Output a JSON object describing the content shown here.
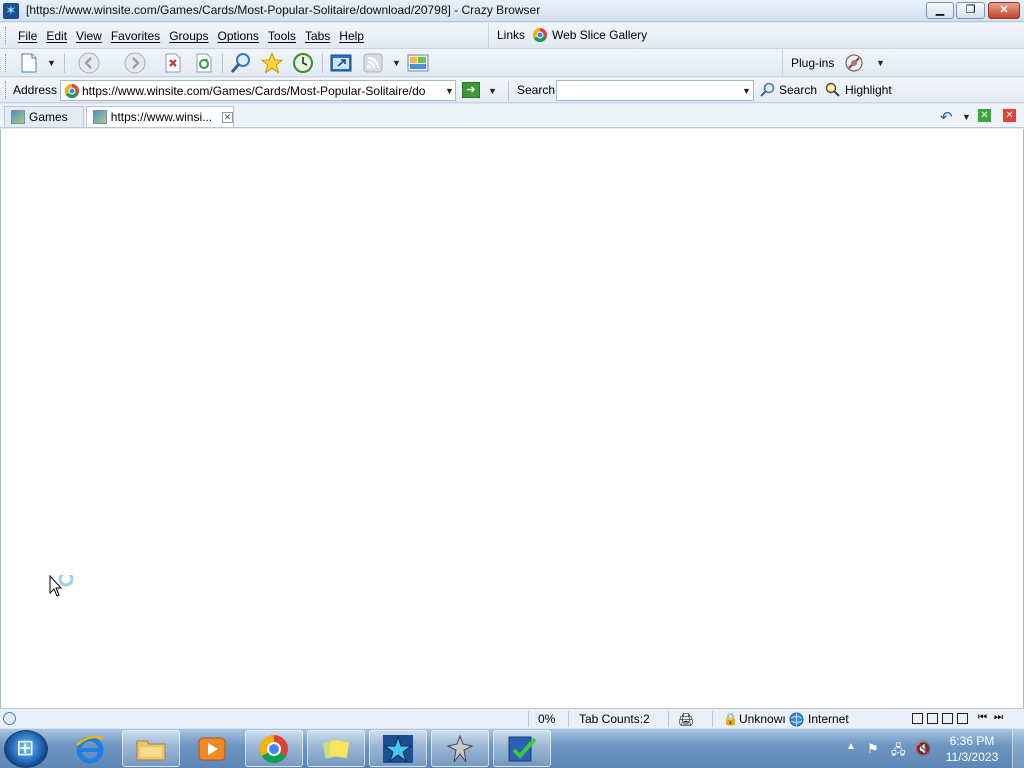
{
  "window": {
    "title": "[https://www.winsite.com/Games/Cards/Most-Popular-Solitaire/download/20798] - Crazy Browser",
    "minimize": "▁",
    "maximize": "❐",
    "close": "✕"
  },
  "menu": {
    "items": [
      "File",
      "Edit",
      "View",
      "Favorites",
      "Groups",
      "Options",
      "Tools",
      "Tabs",
      "Help"
    ]
  },
  "links": {
    "label": "Links",
    "web_slice_gallery": "Web Slice Gallery"
  },
  "toolbar": {
    "icons": [
      "new-page-icon",
      "back-icon",
      "forward-icon",
      "stop-icon",
      "refresh-icon",
      "search-icon",
      "favorites-star-icon",
      "history-icon",
      "fullscreen-icon",
      "rss-feed-icon",
      "image-icon"
    ],
    "plugins_label": "Plug-ins"
  },
  "address": {
    "label": "Address",
    "url": "https://www.winsite.com/Games/Cards/Most-Popular-Solitaire/do"
  },
  "search": {
    "label": "Search",
    "value": "",
    "button_label": "Search",
    "highlight_label": "Highlight"
  },
  "tabs": [
    {
      "label": "Games",
      "active": false
    },
    {
      "label": "https://www.winsi...",
      "active": true
    }
  ],
  "status": {
    "progress": "0%",
    "tab_counts": "Tab Counts:2",
    "security": "Unknowı",
    "zone": "Internet"
  },
  "taskbar": {
    "apps": [
      "internet-explorer",
      "file-explorer",
      "media-player",
      "chrome",
      "sticky-notes",
      "crazy-browser",
      "app-figure",
      "checklist-app"
    ],
    "clock_time": "6:36 PM",
    "clock_date": "11/3/2023"
  }
}
